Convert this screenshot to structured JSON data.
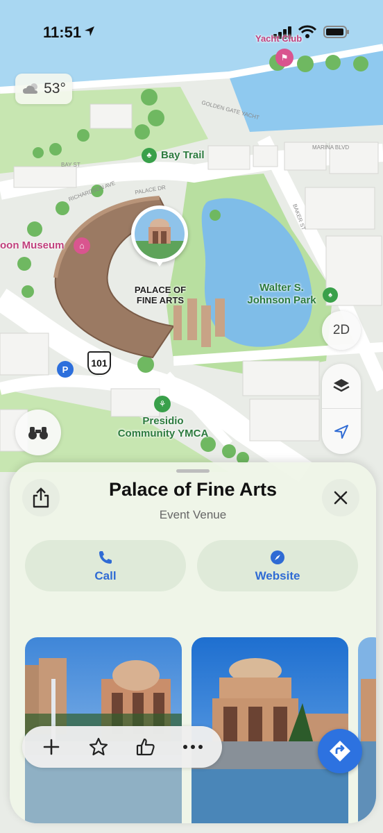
{
  "status_bar": {
    "time": "11:51"
  },
  "weather": {
    "temperature": "53°",
    "icon": "cloud-sun-icon"
  },
  "map_labels": {
    "yacht_club": "Yacht Club",
    "bay_trail": "Bay Trail",
    "museum": "oon Museum",
    "palace_line1": "PALACE OF",
    "palace_line2": "FINE ARTS",
    "park_line1": "Walter S.",
    "park_line2": "Johnson Park",
    "ymca_line1": "Presidio",
    "ymca_line2": "Community YMCA",
    "highway": "101",
    "parking": "P",
    "street_baker": "BAKER ST",
    "street_marina": "MARINA BLVD",
    "street_golden_gate": "GOLDEN GATE YACHT",
    "street_bay": "BAY ST",
    "street_palace": "PALACE DR",
    "street_richardson": "RICHARDSON AVE"
  },
  "map_controls": {
    "view_mode": "2D",
    "layers_icon": "layers-icon",
    "location_icon": "location-arrow-icon",
    "lookaround_icon": "binoculars-icon"
  },
  "place": {
    "name": "Palace of Fine Arts",
    "category": "Event Venue",
    "actions": [
      {
        "label": "Call",
        "icon": "phone-icon"
      },
      {
        "label": "Website",
        "icon": "compass-icon"
      }
    ]
  },
  "toolbar": {
    "buttons": [
      "add-icon",
      "star-icon",
      "thumbs-up-icon",
      "more-icon"
    ]
  },
  "colors": {
    "accent": "#2f6bd4",
    "park": "#bfe0a8",
    "water": "#86c4ec",
    "road": "#ffffff",
    "pink_poi": "#c03f7c"
  }
}
